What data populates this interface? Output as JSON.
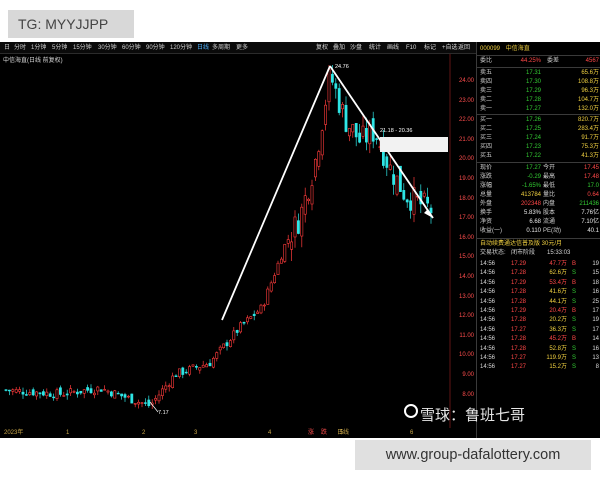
{
  "overlay": {
    "tg_label": "TG: MYYJJPP",
    "url_label": "www.group-dafalottery.com",
    "watermark": "雪球：鲁班七哥"
  },
  "toolbar": {
    "left_items": [
      "日",
      "分时",
      "1分钟",
      "5分钟",
      "15分钟",
      "30分钟",
      "60分钟",
      "90分钟",
      "120分钟",
      "日线",
      "多周期",
      "更多"
    ],
    "active_item": "日线",
    "right_items": [
      "复权",
      "叠加",
      "沙盘",
      "统计",
      "画线",
      "F10",
      "标记",
      "+自选",
      "返回"
    ]
  },
  "chart": {
    "title": "中信海直(日线 前复权)",
    "high_label": "24.76",
    "low_label": "7.17",
    "range_label": "21.18 - 20.36",
    "y_axis": [
      "24.00",
      "23.00",
      "22.00",
      "21.00",
      "20.00",
      "19.00",
      "18.00",
      "17.00",
      "16.00",
      "15.00",
      "14.00",
      "13.00",
      "12.00",
      "11.00",
      "10.00",
      "9.00",
      "8.00"
    ],
    "x_axis": [
      "2023年",
      "1",
      "2",
      "3",
      "4",
      "5",
      "6"
    ],
    "bottom_tabs": [
      "涨",
      "跌",
      "日线"
    ],
    "colors": {
      "up": "#ff3b3b",
      "down": "#2ee6e6",
      "trend": "#ffffff"
    }
  },
  "panel": {
    "code": "000099",
    "name": "中信海直",
    "wei_bi_label": "委比",
    "wei_bi": "44.25%",
    "wei_cha_label": "委差",
    "wei_cha": "4567",
    "asks": [
      {
        "label": "卖五",
        "price": "17.31",
        "vol": "65.6万"
      },
      {
        "label": "卖四",
        "price": "17.30",
        "vol": "108.8万"
      },
      {
        "label": "卖三",
        "price": "17.29",
        "vol": "96.3万"
      },
      {
        "label": "卖二",
        "price": "17.28",
        "vol": "104.7万"
      },
      {
        "label": "卖一",
        "price": "17.27",
        "vol": "132.0万"
      }
    ],
    "bids": [
      {
        "label": "买一",
        "price": "17.26",
        "vol": "820.7万"
      },
      {
        "label": "买二",
        "price": "17.25",
        "vol": "283.4万"
      },
      {
        "label": "买三",
        "price": "17.24",
        "vol": "91.7万"
      },
      {
        "label": "买四",
        "price": "17.23",
        "vol": "75.3万"
      },
      {
        "label": "买五",
        "price": "17.22",
        "vol": "41.3万"
      }
    ],
    "stats": [
      {
        "l1": "现价",
        "v1": "17.27",
        "l2": "今开",
        "v2": "17.45"
      },
      {
        "l1": "涨跌",
        "v1": "-0.29",
        "l2": "最高",
        "v2": "17.48"
      },
      {
        "l1": "涨幅",
        "v1": "-1.65%",
        "l2": "最低",
        "v2": "17.0"
      },
      {
        "l1": "总量",
        "v1": "413784",
        "l2": "量比",
        "v2": "0.64"
      },
      {
        "l1": "外盘",
        "v1": "202348",
        "l2": "内盘",
        "v2": "211436"
      },
      {
        "l1": "换手",
        "v1": "5.83%",
        "l2": "股本",
        "v2": "7.76亿"
      },
      {
        "l1": "净资",
        "v1": "6.68",
        "l2": "流通",
        "v2": "7.10亿"
      },
      {
        "l1": "收益(一)",
        "v1": "0.110",
        "l2": "PE(动)",
        "v2": "40.1"
      }
    ],
    "notice": "自动续费通达信普及版  30元/月",
    "trade_status_label": "交易状态:",
    "trade_status": "闭市阶段",
    "trade_status_time": "15:33:03",
    "ticks": [
      {
        "time": "14:56",
        "price": "17.29",
        "vol": "47.7万",
        "side": "B",
        "cnt": "19"
      },
      {
        "time": "14:56",
        "price": "17.28",
        "vol": "62.6万",
        "side": "S",
        "cnt": "15"
      },
      {
        "time": "14:56",
        "price": "17.29",
        "vol": "53.4万",
        "side": "B",
        "cnt": "18"
      },
      {
        "time": "14:56",
        "price": "17.28",
        "vol": "41.6万",
        "side": "S",
        "cnt": "16"
      },
      {
        "time": "14:56",
        "price": "17.28",
        "vol": "44.1万",
        "side": "S",
        "cnt": "25"
      },
      {
        "time": "14:56",
        "price": "17.29",
        "vol": "20.4万",
        "side": "B",
        "cnt": "17"
      },
      {
        "time": "14:56",
        "price": "17.28",
        "vol": "20.2万",
        "side": "S",
        "cnt": "19"
      },
      {
        "time": "14:56",
        "price": "17.27",
        "vol": "36.3万",
        "side": "S",
        "cnt": "17"
      },
      {
        "time": "14:56",
        "price": "17.28",
        "vol": "45.2万",
        "side": "B",
        "cnt": "14"
      },
      {
        "time": "14:56",
        "price": "17.28",
        "vol": "52.8万",
        "side": "S",
        "cnt": "16"
      },
      {
        "time": "14:56",
        "price": "17.27",
        "vol": "119.9万",
        "side": "S",
        "cnt": "13"
      },
      {
        "time": "14:56",
        "price": "17.27",
        "vol": "15.2万",
        "side": "S",
        "cnt": "8"
      }
    ]
  }
}
